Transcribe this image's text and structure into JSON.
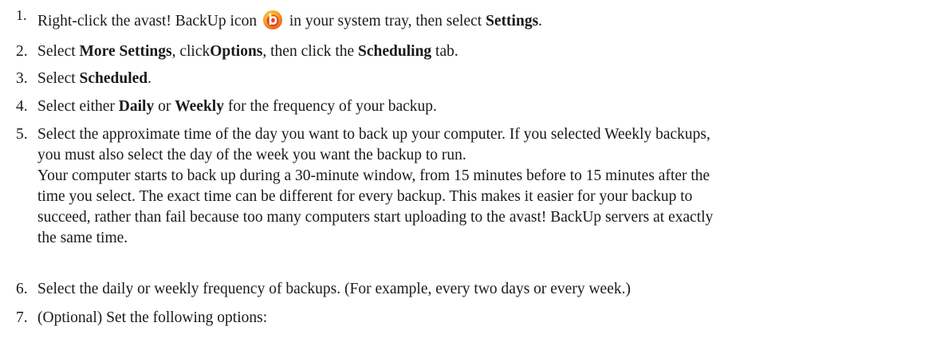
{
  "steps": [
    {
      "number": "1.",
      "t1": "Right-click the avast! BackUp icon ",
      "icon": "avast-backup-tray-icon",
      "t2": " in your system tray, then select ",
      "b1": "Settings",
      "t3": "."
    },
    {
      "number": "2.",
      "t1": "Select ",
      "b1": "More Settings",
      "t2": ", click",
      "b2": "Options",
      "t3": ", then click the ",
      "b3": "Scheduling",
      "t4": " tab."
    },
    {
      "number": "3.",
      "t1": "Select ",
      "b1": "Scheduled",
      "t2": "."
    },
    {
      "number": "4.",
      "t1": "Select either ",
      "b1": "Daily",
      "t2": " or ",
      "b2": "Weekly",
      "t3": " for the frequency of your backup."
    },
    {
      "number": "5.",
      "line1": "Select the approximate time of the day you want to back up your computer. If you selected Weekly backups,",
      "line2": "you must also select the day of the week you want the backup to run.",
      "line3": "Your computer starts to back up during a 30-minute window, from 15 minutes before to 15 minutes after the",
      "line4": "time you select. The exact time can be different for every backup. This makes it easier for your backup to",
      "line5": "succeed, rather than fail because too many computers start uploading to the avast! BackUp servers at exactly",
      "line6": "the same time."
    },
    {
      "number": "6.",
      "t1": "Select the daily or weekly frequency of backups. (For example, every two days or every week.)"
    },
    {
      "number": "7.",
      "t1": "(Optional) Set the following options:"
    }
  ],
  "colors": {
    "text": "#1a1a1a",
    "icon_outer": "#f5a623",
    "icon_inner": "#e8411e"
  }
}
